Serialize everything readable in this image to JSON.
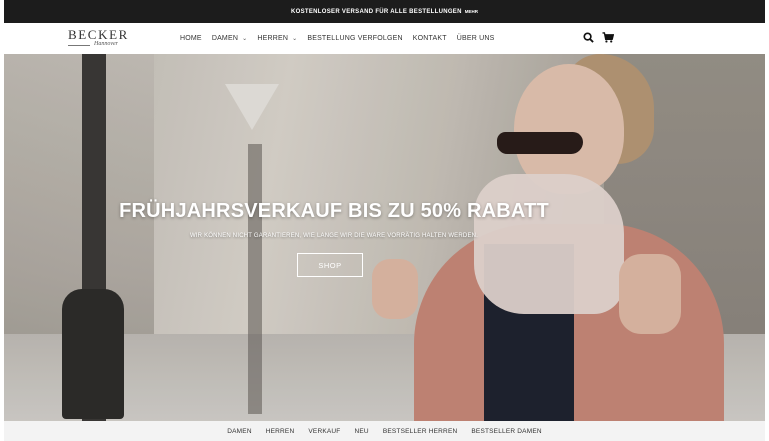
{
  "announcement": {
    "text": "KOSTENLOSER VERSAND FÜR ALLE BESTELLUNGEN",
    "badge": "MEHR"
  },
  "header": {
    "logo": {
      "brand": "BECKER",
      "script": "Hannover"
    },
    "nav": [
      {
        "label": "HOME",
        "dropdown": false
      },
      {
        "label": "DAMEN",
        "dropdown": true
      },
      {
        "label": "HERREN",
        "dropdown": true
      },
      {
        "label": "BESTELLUNG VERFOLGEN",
        "dropdown": false
      },
      {
        "label": "KONTAKT",
        "dropdown": false
      },
      {
        "label": "ÜBER UNS",
        "dropdown": false
      }
    ],
    "icons": [
      "search-icon",
      "cart-icon"
    ]
  },
  "hero": {
    "title": "FRÜHJAHRSVERKAUF BIS ZU 50% RABATT",
    "subtitle": "WIR KÖNNEN NICHT GARANTIEREN, WIE LANGE WIR DIE WARE VORRÄTIG HALTEN WERDEN.",
    "button": "SHOP"
  },
  "footer_nav": [
    "DAMEN",
    "HERREN",
    "VERKAUF",
    "NEU",
    "BESTSELLER HERREN",
    "BESTSELLER DAMEN"
  ],
  "colors": {
    "announcement_bg": "#1c1c1c",
    "header_bg": "#ffffff",
    "hero_text": "#ffffff",
    "footer_nav_bg": "#f3f3f3"
  }
}
